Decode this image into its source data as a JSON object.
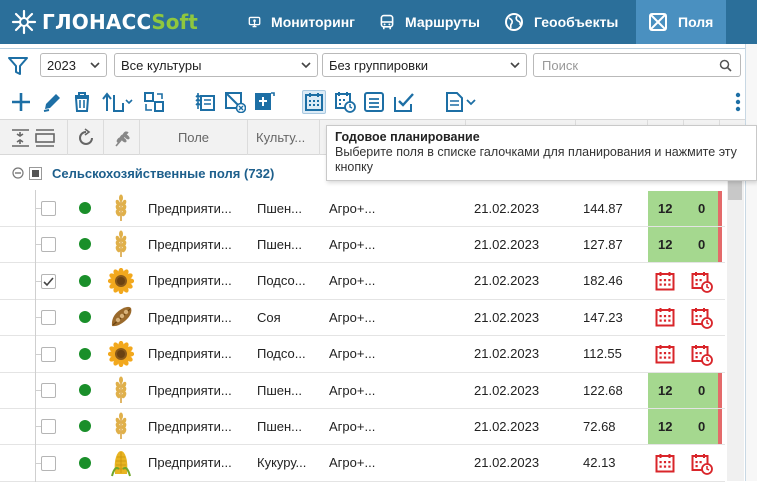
{
  "logo": {
    "part1": "ГЛОНАСС",
    "part2": "Soft"
  },
  "nav": {
    "items": [
      {
        "label": "Мониторинг",
        "icon": "monitor-icon"
      },
      {
        "label": "Маршруты",
        "icon": "bus-icon"
      },
      {
        "label": "Геообъекты",
        "icon": "globe-icon"
      },
      {
        "label": "Поля",
        "icon": "field-icon"
      }
    ],
    "active": "Поля"
  },
  "filters": {
    "year": "2023",
    "crops": "Все культуры",
    "grouping": "Без группировки",
    "search_placeholder": "Поиск"
  },
  "header": {
    "field": "Поле",
    "crop": "Культу..."
  },
  "tooltip": {
    "title": "Годовое планирование",
    "text": "Выберите поля в списке галочками для планирования и нажмите эту кнопку"
  },
  "group": {
    "title": "Сельскохозяйственные поля (732)"
  },
  "rows": [
    {
      "field": "Предприяти...",
      "crop": "Пшен...",
      "org": "Агро+...",
      "date": "21.02.2023",
      "area": "144.87",
      "checked": false,
      "crop_icon": "wheat-icon",
      "status": "green",
      "count": "12",
      "zero": "0"
    },
    {
      "field": "Предприяти...",
      "crop": "Пшен...",
      "org": "Агро+...",
      "date": "21.02.2023",
      "area": "127.87",
      "checked": false,
      "crop_icon": "wheat-icon",
      "status": "green",
      "count": "12",
      "zero": "0"
    },
    {
      "field": "Предприяти...",
      "crop": "Подсо...",
      "org": "Агро+...",
      "date": "21.02.2023",
      "area": "182.46",
      "checked": true,
      "crop_icon": "sunflower-icon",
      "status": "calendar"
    },
    {
      "field": "Предприяти...",
      "crop": "Соя",
      "org": "Агро+...",
      "date": "21.02.2023",
      "area": "147.23",
      "checked": false,
      "crop_icon": "soy-icon",
      "status": "calendar"
    },
    {
      "field": "Предприяти...",
      "crop": "Подсо...",
      "org": "Агро+...",
      "date": "21.02.2023",
      "area": "112.55",
      "checked": false,
      "crop_icon": "sunflower-icon",
      "status": "calendar"
    },
    {
      "field": "Предприяти...",
      "crop": "Пшен...",
      "org": "Агро+...",
      "date": "21.02.2023",
      "area": "122.68",
      "checked": false,
      "crop_icon": "wheat-icon",
      "status": "green",
      "count": "12",
      "zero": "0"
    },
    {
      "field": "Предприяти...",
      "crop": "Пшен...",
      "org": "Агро+...",
      "date": "21.02.2023",
      "area": "72.68",
      "checked": false,
      "crop_icon": "wheat-icon",
      "status": "green",
      "count": "12",
      "zero": "0"
    },
    {
      "field": "Предприяти...",
      "crop": "Кукуру...",
      "org": "Агро+...",
      "date": "21.02.2023",
      "area": "42.13",
      "checked": false,
      "crop_icon": "corn-icon",
      "status": "calendar"
    }
  ],
  "colors": {
    "nav_bg": "#2b6f9a",
    "nav_active": "#4a90c0",
    "accent": "#1d6fa5",
    "green_cell": "#a5d88f",
    "status_dot": "#1a8f2a",
    "calendar_red": "#d9252a"
  }
}
